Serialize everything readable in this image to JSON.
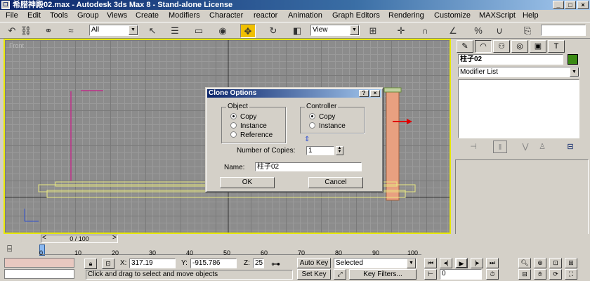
{
  "window": {
    "title": "希腊神殿02.max - Autodesk 3ds Max 8 - Stand-alone License",
    "sys_glyph": "☐",
    "minimize": "_",
    "maximize": "□",
    "close": "×"
  },
  "menu": [
    "File",
    "Edit",
    "Tools",
    "Group",
    "Views",
    "Create",
    "Modifiers",
    "Character",
    "reactor",
    "Animation",
    "Graph Editors",
    "Rendering",
    "Customize",
    "MAXScript",
    "Help"
  ],
  "toolbar": {
    "selection_filter": "All",
    "ref_coord": "View",
    "sel_set": ""
  },
  "viewport": {
    "label": "Front"
  },
  "command_panel": {
    "object_name": "柱子02",
    "object_color": "#3a8a14",
    "modifier_list": "Modifier List",
    "tabs": [
      "create",
      "modify",
      "hierarchy",
      "motion",
      "display",
      "utilities"
    ]
  },
  "dialog": {
    "title": "Clone Options",
    "help_btn": "?",
    "close_btn": "×",
    "object_group": {
      "label": "Object",
      "options": [
        "Copy",
        "Instance",
        "Reference"
      ],
      "selected": "Copy"
    },
    "controller_group": {
      "label": "Controller",
      "options": [
        "Copy",
        "Instance"
      ],
      "selected": "Copy"
    },
    "copies_label": "Number of Copies:",
    "copies_value": "1",
    "name_label": "Name:",
    "name_value": "柱子02",
    "ok": "OK",
    "cancel": "Cancel"
  },
  "timeline": {
    "slider": "0 / 100",
    "ticks": [
      "0",
      "10",
      "20",
      "30",
      "40",
      "50",
      "60",
      "70",
      "80",
      "90",
      "100"
    ],
    "left_arrow": "<",
    "right_arrow": ">"
  },
  "status": {
    "prompt": "Click and drag to select and move objects",
    "x_label": "X:",
    "x_value": "317.19",
    "y_label": "Y:",
    "y_value": "-915.786",
    "z_label": "Z:",
    "z_value": "25",
    "auto_key": "Auto Key",
    "set_key": "Set Key",
    "key_mode": "Selected",
    "key_filters": "Key Filters...",
    "frame": "0"
  }
}
